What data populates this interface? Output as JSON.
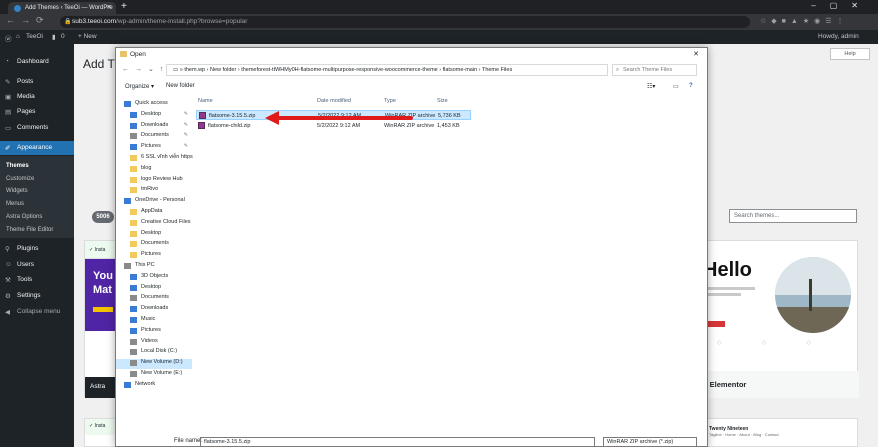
{
  "browser": {
    "tab_title": "Add Themes ‹ TeeOi — WordPre",
    "new_tab": "+",
    "url_host": "sub3.teeoi.com",
    "url_path": "/wp-admin/theme-install.php?browse=popular"
  },
  "adminbar": {
    "site": "TeeOi",
    "comments": "0",
    "new_label": "+ New",
    "howdy": "Howdy, admin"
  },
  "sidebar": {
    "items": [
      {
        "icon": "dashboard-icon",
        "label": "Dashboard"
      },
      {
        "icon": "posts-icon",
        "label": "Posts"
      },
      {
        "icon": "media-icon",
        "label": "Media"
      },
      {
        "icon": "pages-icon",
        "label": "Pages"
      },
      {
        "icon": "comments-icon",
        "label": "Comments"
      },
      {
        "icon": "appearance-icon",
        "label": "Appearance"
      },
      {
        "icon": "plugins-icon",
        "label": "Plugins"
      },
      {
        "icon": "users-icon",
        "label": "Users"
      },
      {
        "icon": "tools-icon",
        "label": "Tools"
      },
      {
        "icon": "settings-icon",
        "label": "Settings"
      },
      {
        "icon": "collapse-icon",
        "label": "Collapse menu"
      }
    ],
    "appearance_sub": [
      "Themes",
      "Customize",
      "Widgets",
      "Menus",
      "Astra Options",
      "Theme File Editor"
    ]
  },
  "main": {
    "title": "Add Th",
    "help": "Help",
    "count": "5006",
    "search_placeholder": "Search themes...",
    "card_left": {
      "installed": "✓ Insta",
      "hero": "You Mat",
      "name": "Astra"
    },
    "card_right": {
      "hello": "Hello",
      "name": "o Elementor"
    },
    "bottom_left": "✓ Insta",
    "bottom_right": {
      "title": "Twenty Nineteen",
      "sub": "Tagline · Home · About · Blog · Contact"
    }
  },
  "dialog": {
    "title": "Open",
    "breadcrumb": [
      "them.wp",
      "New folder",
      "themeforest-ttWHMy0H-flatsome-multipurpose-responsive-woocommerce-theme",
      "flatsome-main",
      "Theme Files"
    ],
    "search_placeholder": "Search Theme Files",
    "organize": "Organize ▾",
    "new_folder": "New folder",
    "nav": [
      {
        "label": "Quick access",
        "icon": "star",
        "level": 0
      },
      {
        "label": "Desktop",
        "icon": "blue",
        "level": 1,
        "pin": true
      },
      {
        "label": "Downloads",
        "icon": "blue",
        "level": 1,
        "pin": true
      },
      {
        "label": "Documents",
        "icon": "grey",
        "level": 1,
        "pin": true
      },
      {
        "label": "Pictures",
        "icon": "blue",
        "level": 1,
        "pin": true
      },
      {
        "label": "6 SSL vĩnh viễn https",
        "icon": "fld",
        "level": 1
      },
      {
        "label": "blog",
        "icon": "fld",
        "level": 1
      },
      {
        "label": "logo Review Hub",
        "icon": "fld",
        "level": 1
      },
      {
        "label": "tmRivo",
        "icon": "fld",
        "level": 1
      },
      {
        "label": "OneDrive - Personal",
        "icon": "blue",
        "level": 0
      },
      {
        "label": "AppData",
        "icon": "fld",
        "level": 1
      },
      {
        "label": "Creative Cloud Files",
        "icon": "fld",
        "level": 1
      },
      {
        "label": "Desktop",
        "icon": "fld",
        "level": 1
      },
      {
        "label": "Documents",
        "icon": "fld",
        "level": 1
      },
      {
        "label": "Pictures",
        "icon": "fld",
        "level": 1
      },
      {
        "label": "This PC",
        "icon": "grey",
        "level": 0
      },
      {
        "label": "3D Objects",
        "icon": "blue",
        "level": 1
      },
      {
        "label": "Desktop",
        "icon": "blue",
        "level": 1
      },
      {
        "label": "Documents",
        "icon": "grey",
        "level": 1
      },
      {
        "label": "Downloads",
        "icon": "blue",
        "level": 1
      },
      {
        "label": "Music",
        "icon": "blue",
        "level": 1
      },
      {
        "label": "Pictures",
        "icon": "blue",
        "level": 1
      },
      {
        "label": "Videos",
        "icon": "grey",
        "level": 1
      },
      {
        "label": "Local Disk (C:)",
        "icon": "grey",
        "level": 1
      },
      {
        "label": "New Volume (D:)",
        "icon": "grey",
        "level": 1,
        "selected": true
      },
      {
        "label": "New Volume (E:)",
        "icon": "grey",
        "level": 1
      },
      {
        "label": "Network",
        "icon": "blue",
        "level": 0
      }
    ],
    "columns": [
      "Name",
      "Date modified",
      "Type",
      "Size"
    ],
    "files": [
      {
        "name": "flatsome-3.15.5.zip",
        "date": "5/2/2022 9:12 AM",
        "type": "WinRAR ZIP archive",
        "size": "5,736 KB",
        "selected": true
      },
      {
        "name": "flatsome-child.zip",
        "date": "5/2/2022 9:12 AM",
        "type": "WinRAR ZIP archive",
        "size": "1,453 KB",
        "selected": false
      }
    ],
    "filename_label": "File name:",
    "filename_value": "flatsome-3.15.5.zip",
    "filetype_value": "WinRAR ZIP archive (*.zip)"
  },
  "colors": {
    "wp_dark": "#1d2327",
    "wp_blue": "#2271b1",
    "arrow_red": "#e0191b",
    "selection": "#cce8ff"
  }
}
